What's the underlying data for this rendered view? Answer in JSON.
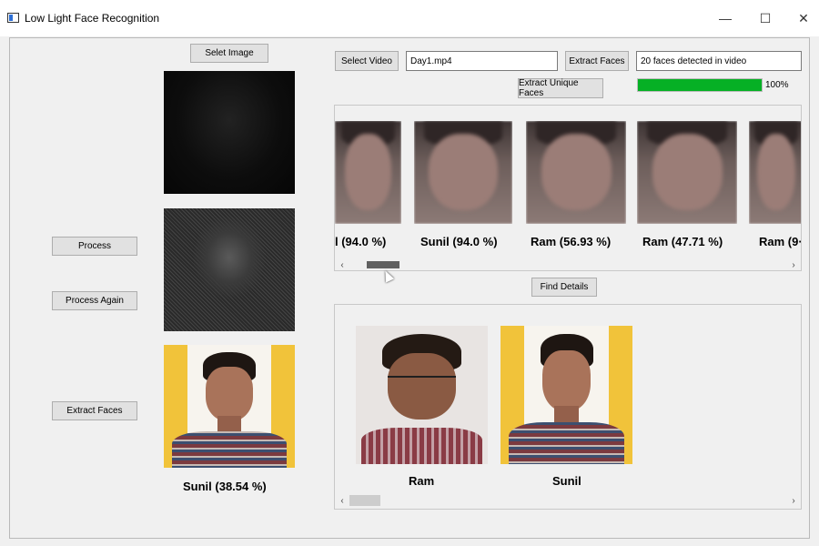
{
  "window": {
    "title": "Low Light Face Recognition",
    "minimize": "—",
    "maximize": "☐",
    "close": "✕"
  },
  "left_panel": {
    "select_image_label": "Selet Image",
    "process_label": "Process",
    "process_again_label": "Process Again",
    "extract_faces_label": "Extract Faces",
    "result_label": "Sunil (38.54 %)"
  },
  "video_panel": {
    "select_video_label": "Select Video",
    "video_file": "Day1.mp4",
    "extract_faces_label": "Extract Faces",
    "status_text": "20 faces detected in video",
    "extract_unique_label": "Extract Unique Faces",
    "progress_percent": 100,
    "progress_text": "100%",
    "detected_faces": [
      {
        "label": "l (94.0 %)"
      },
      {
        "label": "Sunil (94.0 %)"
      },
      {
        "label": "Ram (56.93 %)"
      },
      {
        "label": "Ram (47.71 %)"
      },
      {
        "label": "Ram (9·"
      }
    ],
    "find_details_label": "Find Details"
  },
  "results_panel": {
    "people": [
      {
        "name": "Ram"
      },
      {
        "name": "Sunil"
      }
    ]
  },
  "scroll_arrows": {
    "left": "‹",
    "right": "›"
  },
  "colors": {
    "progress_fill": "#06b025",
    "panel_bg": "#f0f0f0",
    "button_bg": "#e1e1e1"
  }
}
